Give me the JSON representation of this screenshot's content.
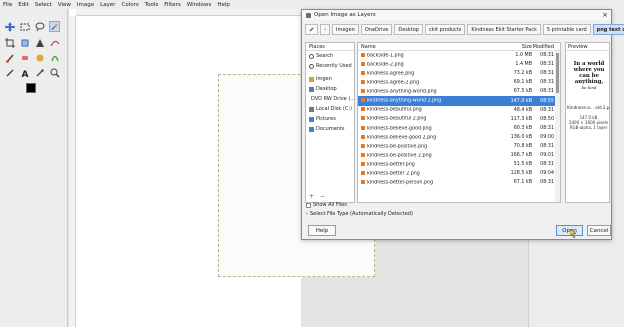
{
  "menubar": [
    "File",
    "Edit",
    "Select",
    "View",
    "Image",
    "Layer",
    "Colors",
    "Tools",
    "Filters",
    "Windows",
    "Help"
  ],
  "dialog": {
    "title": "Open Image as Layers",
    "path": [
      "Imegen",
      "OneDrive",
      "Desktop",
      "ckit products",
      "Kindness Ekit Starter Pack",
      "5 printable card",
      "png text only"
    ],
    "places_header": "Places",
    "places": [
      {
        "label": "Search",
        "icon": "search-icon"
      },
      {
        "label": "Recently Used",
        "icon": "clock-icon"
      },
      {
        "label": "Imgen",
        "icon": "folder-icon"
      },
      {
        "label": "Desktop",
        "icon": "folder-icon"
      },
      {
        "label": "DVD RW Drive (...",
        "icon": "disc-icon"
      },
      {
        "label": "Local Disk (C:)",
        "icon": "drive-icon"
      },
      {
        "label": "Pictures",
        "icon": "folder-icon"
      },
      {
        "label": "Documents",
        "icon": "folder-icon"
      }
    ],
    "places_add": "+",
    "places_remove": "−",
    "columns": {
      "name": "Name",
      "size": "Size",
      "modified": "Modified"
    },
    "files": [
      {
        "name": "backside-1.png",
        "size": "1.0 MB",
        "mod": "08:31",
        "selected": false
      },
      {
        "name": "backside-2.png",
        "size": "1.4 MB",
        "mod": "08:31",
        "selected": false
      },
      {
        "name": "kindness-agree.png",
        "size": "73.2 kB",
        "mod": "08:31",
        "selected": false
      },
      {
        "name": "kindness-agree-2.png",
        "size": "69.1 kB",
        "mod": "08:31",
        "selected": false
      },
      {
        "name": "kindness-anything-world.png",
        "size": "67.5 kB",
        "mod": "08:31",
        "selected": false
      },
      {
        "name": "kindness-anything-world 2.png",
        "size": "147.0 kB",
        "mod": "08:55",
        "selected": true
      },
      {
        "name": "kindness-beautiful.png",
        "size": "48.4 kB",
        "mod": "08:31",
        "selected": false
      },
      {
        "name": "kindness-beautiful 2.png",
        "size": "117.3 kB",
        "mod": "08:50",
        "selected": false
      },
      {
        "name": "kindness-believe-good.png",
        "size": "60.3 kB",
        "mod": "08:31",
        "selected": false
      },
      {
        "name": "kindness-believe-good 2.png",
        "size": "136.0 kB",
        "mod": "09:00",
        "selected": false
      },
      {
        "name": "kindness-be-positive.png",
        "size": "70.8 kB",
        "mod": "08:31",
        "selected": false
      },
      {
        "name": "kindness-be-positive 2.png",
        "size": "166.7 kB",
        "mod": "09:01",
        "selected": false
      },
      {
        "name": "kindness-better.png",
        "size": "51.5 kB",
        "mod": "08:31",
        "selected": false
      },
      {
        "name": "kindness-better 2.png",
        "size": "128.5 kB",
        "mod": "09:04",
        "selected": false
      },
      {
        "name": "kindness-better-person.png",
        "size": "67.1 kB",
        "mod": "08:31",
        "selected": false
      }
    ],
    "preview": {
      "header": "Preview",
      "art_line1": "In a world",
      "art_line2": "where you",
      "art_line3": "can be",
      "art_line4": "anything,",
      "art_line5": "be kind",
      "filename": "Kindness-a... old 2.png",
      "info1": "147.0 kB",
      "info2": "2400 × 3000 pixels",
      "info3": "RGB-alpha, 1 layer"
    },
    "show_all_files": "Show All Files",
    "select_type": "Select File Type (Automatically Detected)",
    "help": "Help",
    "open": "Open",
    "cancel": "Cancel"
  }
}
